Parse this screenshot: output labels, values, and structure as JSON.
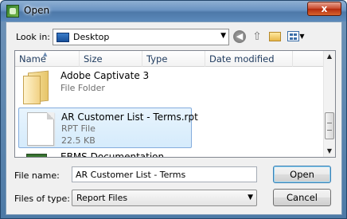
{
  "window": {
    "title": "Open",
    "close_label": "x"
  },
  "toolbar": {
    "lookin_label": "Look in:",
    "lookin_value": "Desktop"
  },
  "columns": {
    "name": "Name",
    "size": "Size",
    "type": "Type",
    "date": "Date modified"
  },
  "items": [
    {
      "name": "Adobe Captivate 3",
      "type": "File Folder"
    },
    {
      "name": "AR Customer List - Terms.rpt",
      "type": "RPT File",
      "size": "22.5 KB",
      "selected": true
    },
    {
      "name": "EBMS Documentation -"
    }
  ],
  "form": {
    "file_name_label": "File name:",
    "file_name_value": "AR Customer List - Terms",
    "file_type_label": "Files of type:",
    "file_type_value": "Report Files",
    "open_label": "Open",
    "cancel_label": "Cancel"
  },
  "icons": {
    "app": "app-icon",
    "back": "back-icon",
    "up": "up-folder-icon",
    "new_folder": "new-folder-icon",
    "views": "views-icon",
    "desktop": "desktop-icon",
    "folder": "folder-icon",
    "file": "file-icon"
  }
}
